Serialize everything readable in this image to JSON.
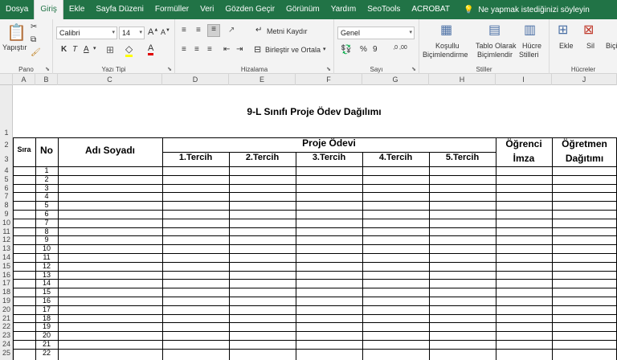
{
  "menu": {
    "tabs": [
      "Dosya",
      "Giriş",
      "Ekle",
      "Sayfa Düzeni",
      "Formüller",
      "Veri",
      "Gözden Geçir",
      "Görünüm",
      "Yardım",
      "SeoTools",
      "ACROBAT"
    ],
    "active": "Giriş",
    "tell_me": "Ne yapmak istediğinizi söyleyin"
  },
  "ribbon": {
    "clipboard": {
      "paste": "Yapıştır",
      "label": "Pano"
    },
    "font": {
      "name": "Calibri",
      "size": "14",
      "bold": "K",
      "italic": "T",
      "underline": "A",
      "label": "Yazı Tipi"
    },
    "alignment": {
      "wrap": "Metni Kaydır",
      "merge": "Birleştir ve Ortala",
      "label": "Hizalama"
    },
    "number": {
      "format": "Genel",
      "percent": "%",
      "thousands": "9",
      "inc_dec": ",0 ,00",
      "label": "Sayı"
    },
    "styles": {
      "conditional_1": "Koşullu",
      "conditional_2": "Biçimlendirme",
      "table_1": "Tablo Olarak",
      "table_2": "Biçimlendir",
      "cell_1": "Hücre",
      "cell_2": "Stilleri",
      "label": "Stiller"
    },
    "cells": {
      "insert": "Ekle",
      "delete": "Sil",
      "format": "Biçi",
      "label": "Hücreler"
    }
  },
  "columns": [
    "A",
    "B",
    "C",
    "D",
    "E",
    "F",
    "G",
    "H",
    "I",
    "J"
  ],
  "rows": [
    "1",
    "2",
    "3",
    "4",
    "5",
    "6",
    "7",
    "8",
    "9",
    "10",
    "11",
    "12",
    "13",
    "14",
    "15",
    "16",
    "17",
    "18",
    "19",
    "20",
    "21",
    "22",
    "23",
    "24",
    "25"
  ],
  "sheet": {
    "title": "9-L Sınıfı Proje Ödev Dağılımı",
    "sira": "Sıra",
    "no": "No",
    "adi": "Adı Soyadı",
    "proje": "Proje Ödevi",
    "tercihler": [
      "1.Tercih",
      "2.Tercih",
      "3.Tercih",
      "4.Tercih",
      "5.Tercih"
    ],
    "ogrenci_1": "Öğrenci",
    "ogrenci_2": "İmza",
    "ogretmen_1": "Öğretmen",
    "ogretmen_2": "Dağıtımı",
    "sira_numbers": [
      "1",
      "2",
      "3",
      "4",
      "5",
      "6",
      "7",
      "8",
      "9",
      "10",
      "11",
      "12",
      "13",
      "14",
      "15",
      "16",
      "17",
      "18",
      "19",
      "20",
      "21",
      "22"
    ]
  }
}
